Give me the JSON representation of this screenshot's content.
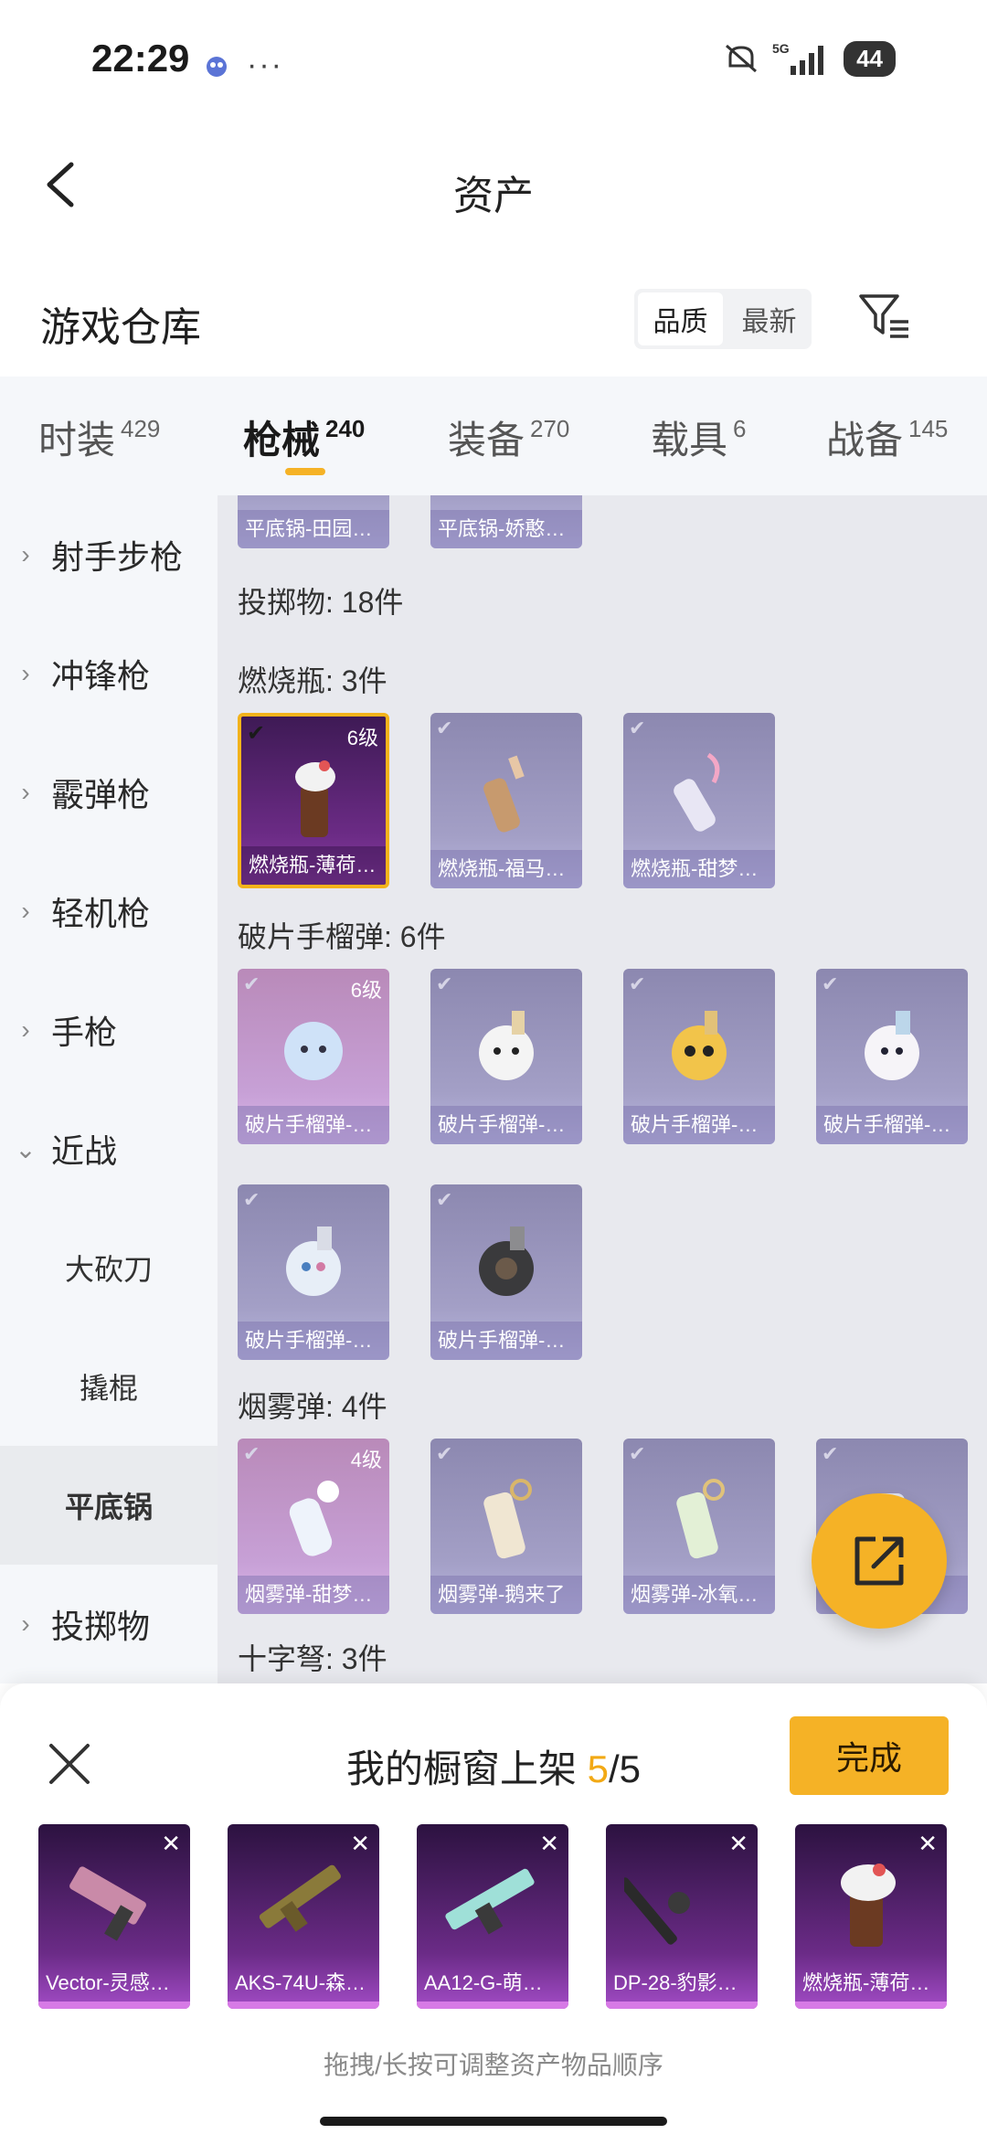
{
  "status_bar": {
    "time": "22:29",
    "network": "5G",
    "battery": "44"
  },
  "header": {
    "title": "资产"
  },
  "repo": {
    "title": "游戏仓库",
    "sort_options": [
      "品质",
      "最新"
    ],
    "sort_active": "品质"
  },
  "tabs": [
    {
      "label": "时装",
      "count": "429"
    },
    {
      "label": "枪械",
      "count": "240"
    },
    {
      "label": "装备",
      "count": "270"
    },
    {
      "label": "载具",
      "count": "6"
    },
    {
      "label": "战备",
      "count": "145"
    }
  ],
  "active_tab": "枪械",
  "sidebar": {
    "items": [
      {
        "label": "射手步枪",
        "chevron": "right"
      },
      {
        "label": "冲锋枪",
        "chevron": "right"
      },
      {
        "label": "霰弹枪",
        "chevron": "right"
      },
      {
        "label": "轻机枪",
        "chevron": "right"
      },
      {
        "label": "手枪",
        "chevron": "right"
      },
      {
        "label": "近战",
        "chevron": "down"
      },
      {
        "label": "大砍刀",
        "chevron": ""
      },
      {
        "label": "撬棍",
        "chevron": ""
      },
      {
        "label": "平底锅",
        "chevron": ""
      },
      {
        "label": "投掷物",
        "chevron": "right"
      }
    ],
    "selected": "平底锅"
  },
  "content": {
    "top_partial_cards": [
      "平底锅-田园…",
      "平底锅-娇憨…"
    ],
    "group_label": "投掷物: 18件",
    "sections": [
      {
        "label": "燃烧瓶: 3件",
        "cards": [
          {
            "name": "燃烧瓶-薄荷…",
            "level": "6级",
            "selected": true
          },
          {
            "name": "燃烧瓶-福马…",
            "level": "",
            "selected": false
          },
          {
            "name": "燃烧瓶-甜梦…",
            "level": "",
            "selected": false
          }
        ]
      },
      {
        "label": "破片手榴弹: 6件",
        "cards": [
          {
            "name": "破片手榴弹-…",
            "level": "6级",
            "selected": false
          },
          {
            "name": "破片手榴弹-…",
            "level": "",
            "selected": false
          },
          {
            "name": "破片手榴弹-…",
            "level": "",
            "selected": false
          },
          {
            "name": "破片手榴弹-…",
            "level": "",
            "selected": false
          },
          {
            "name": "破片手榴弹-…",
            "level": "",
            "selected": false
          },
          {
            "name": "破片手榴弹-…",
            "level": "",
            "selected": false
          }
        ]
      },
      {
        "label": "烟雾弹: 4件",
        "cards": [
          {
            "name": "烟雾弹-甜梦…",
            "level": "4级",
            "selected": false
          },
          {
            "name": "烟雾弹-鹅来了",
            "level": "",
            "selected": false
          },
          {
            "name": "烟雾弹-冰氧…",
            "level": "",
            "selected": false
          },
          {
            "name": "",
            "level": "",
            "selected": false
          }
        ]
      },
      {
        "label": "十字弩: 3件",
        "cards": []
      }
    ]
  },
  "panel": {
    "title_prefix": "我的橱窗上架",
    "current": "5",
    "total": "/5",
    "done_label": "完成",
    "items": [
      {
        "name": "Vector-灵感…"
      },
      {
        "name": "AKS-74U-森…"
      },
      {
        "name": "AA12-G-萌…"
      },
      {
        "name": "DP-28-豹影…"
      },
      {
        "name": "燃烧瓶-薄荷…"
      }
    ],
    "hint": "拖拽/长按可调整资产物品顺序"
  },
  "icons": [
    "back-icon",
    "filter-icon",
    "share-icon",
    "close-icon",
    "check-icon"
  ],
  "colors": {
    "accent": "#f5b226",
    "selected_border": "#f3b31b",
    "count_highlight": "#f2a915"
  }
}
